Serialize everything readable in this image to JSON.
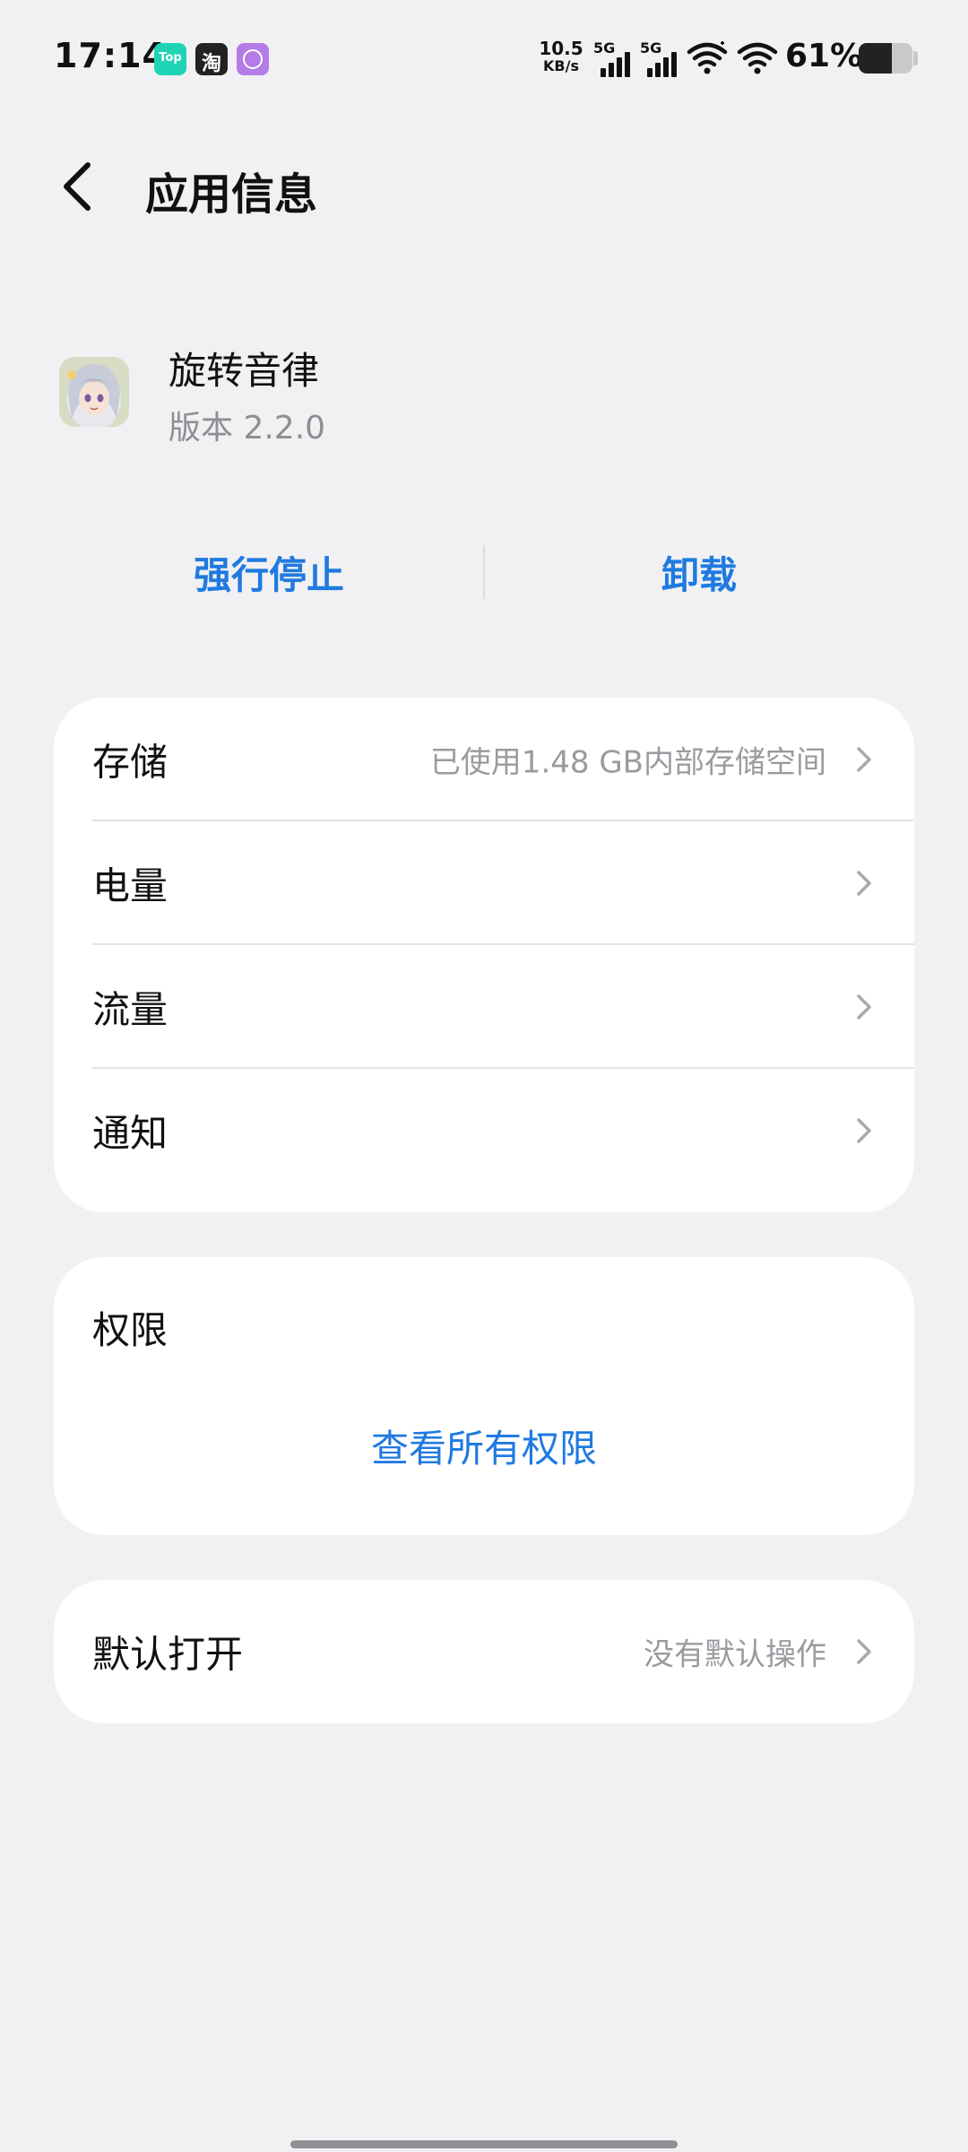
{
  "status_bar": {
    "time": "17:14",
    "notifications": [
      {
        "name": "top-app-icon",
        "text": "Top"
      },
      {
        "name": "taobao-icon",
        "text": "淘"
      },
      {
        "name": "purple-app-icon"
      }
    ],
    "net_speed_value": "10.5",
    "net_speed_unit": "KB/s",
    "signal_1_label": "5G",
    "signal_2_label": "5G",
    "battery_percent": "61%",
    "battery_level": 0.61
  },
  "header": {
    "back_icon": "chevron-left-icon",
    "title": "应用信息"
  },
  "app": {
    "icon": "app-icon-anime-character",
    "name": "旋转音律",
    "version": "版本 2.2.0"
  },
  "actions": {
    "force_stop_label": "强行停止",
    "uninstall_label": "卸载"
  },
  "main_list": {
    "items": [
      {
        "label": "存储",
        "value": "已使用1.48 GB内部存储空间"
      },
      {
        "label": "电量",
        "value": ""
      },
      {
        "label": "流量",
        "value": ""
      },
      {
        "label": "通知",
        "value": ""
      }
    ]
  },
  "permissions": {
    "title": "权限",
    "link_label": "查看所有权限"
  },
  "default_open": {
    "label": "默认打开",
    "value": "没有默认操作"
  },
  "colors": {
    "accent": "#1f7ae0",
    "background": "#f1f1f3",
    "card": "#ffffff",
    "secondary_text": "#9a9aa0"
  }
}
